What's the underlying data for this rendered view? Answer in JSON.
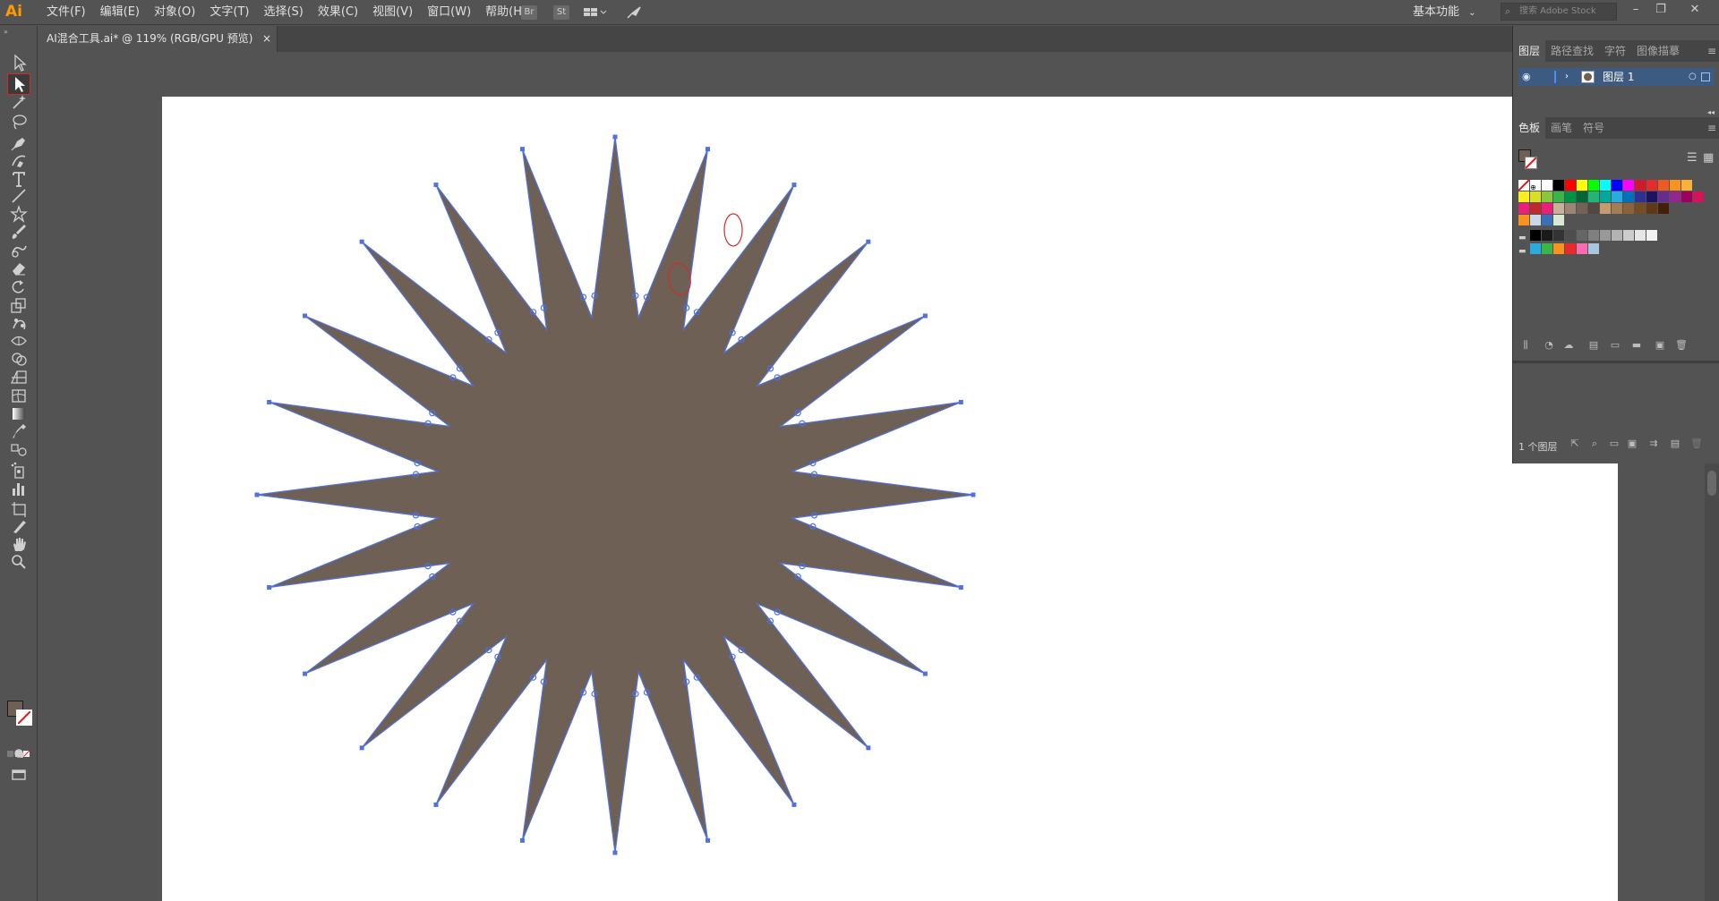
{
  "app": {
    "logo": "Ai"
  },
  "menu": {
    "items": [
      "文件(F)",
      "编辑(E)",
      "对象(O)",
      "文字(T)",
      "选择(S)",
      "效果(C)",
      "视图(V)",
      "窗口(W)",
      "帮助(H)"
    ],
    "bridge": "Br",
    "stock": "St",
    "workspace": "基本功能",
    "search_placeholder": "搜索 Adobe Stock"
  },
  "document": {
    "tab_title": "AI混合工具.ai* @ 119% (RGB/GPU 预览)",
    "close": "×"
  },
  "toolbar": {
    "tools": [
      "selection-tool",
      "direct-selection-tool",
      "magic-wand-tool",
      "lasso-tool",
      "pen-tool",
      "curvature-tool",
      "type-tool",
      "line-segment-tool",
      "star-tool",
      "paintbrush-tool",
      "shaper-tool",
      "eraser-tool",
      "rotate-tool",
      "scale-tool",
      "puppet-warp-tool",
      "width-tool",
      "shape-builder-tool",
      "perspective-grid-tool",
      "mesh-tool",
      "gradient-tool",
      "eyedropper-tool",
      "blend-tool",
      "symbol-sprayer-tool",
      "column-graph-tool",
      "artboard-tool",
      "slice-tool",
      "hand-tool",
      "zoom-tool"
    ],
    "active_tool": "direct-selection-tool",
    "fill_color": "#6e6055"
  },
  "artwork": {
    "fill": "#6e6055",
    "path_color": "#4f72e0",
    "highlight_color": "#d12c2c"
  },
  "panels": {
    "layers_tabs": [
      "图层",
      "路径查找",
      "字符",
      "图像描摹"
    ],
    "layer_name": "图层 1",
    "swatches_tabs": [
      "色板",
      "画笔",
      "符号"
    ],
    "layers_count": "1 个图层",
    "panel_menu": "≡"
  },
  "swatches": {
    "row1": [
      "#ffffff",
      "#000000",
      "#ff0000",
      "#ffff00",
      "#00ff00",
      "#00ffff",
      "#0000ff",
      "#ff00ff",
      "#cc1a2f",
      "#e52b2b",
      "#ee5a24",
      "#f7931e",
      "#fbb03b"
    ],
    "row2": [
      "#fcee21",
      "#d9e021",
      "#8cc63f",
      "#39b54a",
      "#009245",
      "#006837",
      "#22b573",
      "#00a99d",
      "#29abe2",
      "#0071bc",
      "#2e3192",
      "#1b1464",
      "#662d91",
      "#93278f",
      "#9e005d",
      "#d4145a"
    ],
    "row3": [
      "#ed1e79",
      "#c7b299",
      "#998675",
      "#736357",
      "#534741",
      "#c69c6d",
      "#a67c52",
      "#8c6239",
      "#754c24",
      "#603813",
      "#42210b"
    ],
    "row4": [
      "#000000",
      "#1a1a1a",
      "#333333",
      "#4d4d4d",
      "#666666",
      "#808080",
      "#999999",
      "#b3b3b3",
      "#cccccc",
      "#e6e6e6",
      "#f2f2f2"
    ],
    "row5": [
      "#29abe2",
      "#39b54a",
      "#f7931e",
      "#e52b2b",
      "#ff6ab0",
      "#a8c6e0"
    ]
  }
}
